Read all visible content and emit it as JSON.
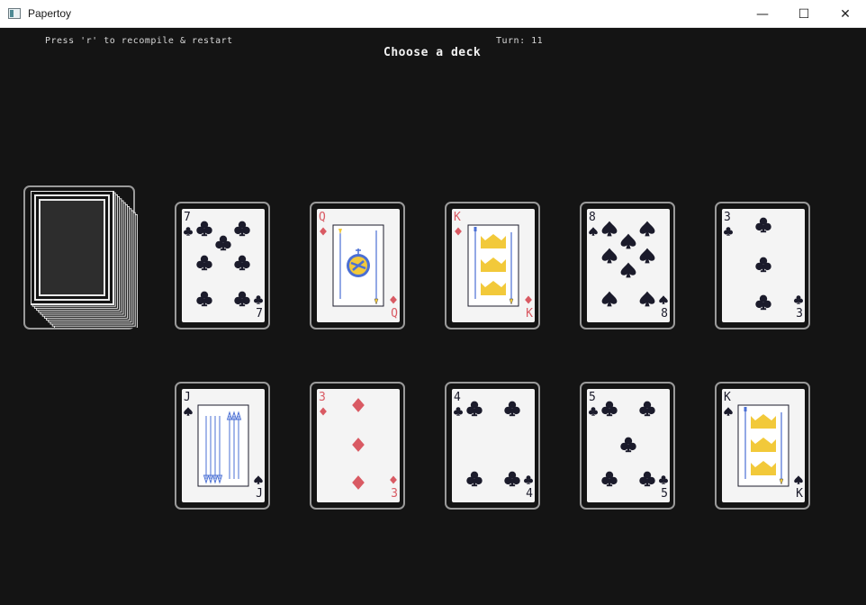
{
  "window": {
    "title": "Papertoy",
    "minimize_glyph": "—",
    "maximize_glyph": "☐",
    "close_glyph": "✕"
  },
  "hud": {
    "hint": "Press 'r' to recompile & restart",
    "turn": "Turn: 11",
    "prompt": "Choose a deck"
  },
  "colors": {
    "black_suit": "#1b1b2b",
    "red_suit": "#d95a63",
    "court_gold": "#f2c93a",
    "court_blue": "#4a6fd4"
  },
  "cards": [
    {
      "rank": "7",
      "suit": "clubs",
      "color": "black",
      "face": false
    },
    {
      "rank": "Q",
      "suit": "diamonds",
      "color": "red",
      "face": true
    },
    {
      "rank": "K",
      "suit": "diamonds",
      "color": "red",
      "face": true
    },
    {
      "rank": "8",
      "suit": "spades",
      "color": "black",
      "face": false
    },
    {
      "rank": "3",
      "suit": "clubs",
      "color": "black",
      "face": false
    },
    {
      "rank": "J",
      "suit": "spades",
      "color": "black",
      "face": true
    },
    {
      "rank": "3",
      "suit": "diamonds",
      "color": "red",
      "face": false
    },
    {
      "rank": "4",
      "suit": "clubs",
      "color": "black",
      "face": false
    },
    {
      "rank": "5",
      "suit": "clubs",
      "color": "black",
      "face": false
    },
    {
      "rank": "K",
      "suit": "spades",
      "color": "black",
      "face": true
    }
  ]
}
